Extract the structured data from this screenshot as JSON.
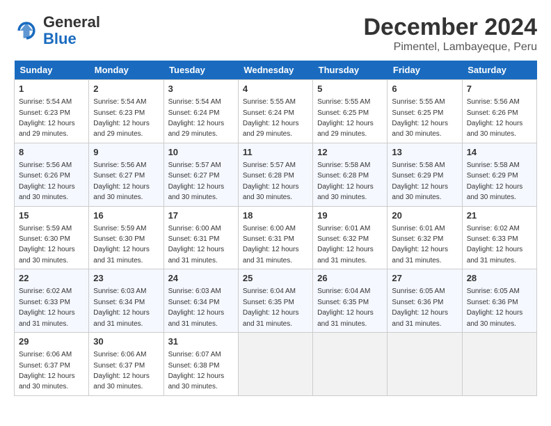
{
  "header": {
    "logo_general": "General",
    "logo_blue": "Blue",
    "month": "December 2024",
    "location": "Pimentel, Lambayeque, Peru"
  },
  "days_of_week": [
    "Sunday",
    "Monday",
    "Tuesday",
    "Wednesday",
    "Thursday",
    "Friday",
    "Saturday"
  ],
  "weeks": [
    [
      {
        "day": 1,
        "info": "Sunrise: 5:54 AM\nSunset: 6:23 PM\nDaylight: 12 hours\nand 29 minutes."
      },
      {
        "day": 2,
        "info": "Sunrise: 5:54 AM\nSunset: 6:23 PM\nDaylight: 12 hours\nand 29 minutes."
      },
      {
        "day": 3,
        "info": "Sunrise: 5:54 AM\nSunset: 6:24 PM\nDaylight: 12 hours\nand 29 minutes."
      },
      {
        "day": 4,
        "info": "Sunrise: 5:55 AM\nSunset: 6:24 PM\nDaylight: 12 hours\nand 29 minutes."
      },
      {
        "day": 5,
        "info": "Sunrise: 5:55 AM\nSunset: 6:25 PM\nDaylight: 12 hours\nand 29 minutes."
      },
      {
        "day": 6,
        "info": "Sunrise: 5:55 AM\nSunset: 6:25 PM\nDaylight: 12 hours\nand 30 minutes."
      },
      {
        "day": 7,
        "info": "Sunrise: 5:56 AM\nSunset: 6:26 PM\nDaylight: 12 hours\nand 30 minutes."
      }
    ],
    [
      {
        "day": 8,
        "info": "Sunrise: 5:56 AM\nSunset: 6:26 PM\nDaylight: 12 hours\nand 30 minutes."
      },
      {
        "day": 9,
        "info": "Sunrise: 5:56 AM\nSunset: 6:27 PM\nDaylight: 12 hours\nand 30 minutes."
      },
      {
        "day": 10,
        "info": "Sunrise: 5:57 AM\nSunset: 6:27 PM\nDaylight: 12 hours\nand 30 minutes."
      },
      {
        "day": 11,
        "info": "Sunrise: 5:57 AM\nSunset: 6:28 PM\nDaylight: 12 hours\nand 30 minutes."
      },
      {
        "day": 12,
        "info": "Sunrise: 5:58 AM\nSunset: 6:28 PM\nDaylight: 12 hours\nand 30 minutes."
      },
      {
        "day": 13,
        "info": "Sunrise: 5:58 AM\nSunset: 6:29 PM\nDaylight: 12 hours\nand 30 minutes."
      },
      {
        "day": 14,
        "info": "Sunrise: 5:58 AM\nSunset: 6:29 PM\nDaylight: 12 hours\nand 30 minutes."
      }
    ],
    [
      {
        "day": 15,
        "info": "Sunrise: 5:59 AM\nSunset: 6:30 PM\nDaylight: 12 hours\nand 30 minutes."
      },
      {
        "day": 16,
        "info": "Sunrise: 5:59 AM\nSunset: 6:30 PM\nDaylight: 12 hours\nand 31 minutes."
      },
      {
        "day": 17,
        "info": "Sunrise: 6:00 AM\nSunset: 6:31 PM\nDaylight: 12 hours\nand 31 minutes."
      },
      {
        "day": 18,
        "info": "Sunrise: 6:00 AM\nSunset: 6:31 PM\nDaylight: 12 hours\nand 31 minutes."
      },
      {
        "day": 19,
        "info": "Sunrise: 6:01 AM\nSunset: 6:32 PM\nDaylight: 12 hours\nand 31 minutes."
      },
      {
        "day": 20,
        "info": "Sunrise: 6:01 AM\nSunset: 6:32 PM\nDaylight: 12 hours\nand 31 minutes."
      },
      {
        "day": 21,
        "info": "Sunrise: 6:02 AM\nSunset: 6:33 PM\nDaylight: 12 hours\nand 31 minutes."
      }
    ],
    [
      {
        "day": 22,
        "info": "Sunrise: 6:02 AM\nSunset: 6:33 PM\nDaylight: 12 hours\nand 31 minutes."
      },
      {
        "day": 23,
        "info": "Sunrise: 6:03 AM\nSunset: 6:34 PM\nDaylight: 12 hours\nand 31 minutes."
      },
      {
        "day": 24,
        "info": "Sunrise: 6:03 AM\nSunset: 6:34 PM\nDaylight: 12 hours\nand 31 minutes."
      },
      {
        "day": 25,
        "info": "Sunrise: 6:04 AM\nSunset: 6:35 PM\nDaylight: 12 hours\nand 31 minutes."
      },
      {
        "day": 26,
        "info": "Sunrise: 6:04 AM\nSunset: 6:35 PM\nDaylight: 12 hours\nand 31 minutes."
      },
      {
        "day": 27,
        "info": "Sunrise: 6:05 AM\nSunset: 6:36 PM\nDaylight: 12 hours\nand 31 minutes."
      },
      {
        "day": 28,
        "info": "Sunrise: 6:05 AM\nSunset: 6:36 PM\nDaylight: 12 hours\nand 30 minutes."
      }
    ],
    [
      {
        "day": 29,
        "info": "Sunrise: 6:06 AM\nSunset: 6:37 PM\nDaylight: 12 hours\nand 30 minutes."
      },
      {
        "day": 30,
        "info": "Sunrise: 6:06 AM\nSunset: 6:37 PM\nDaylight: 12 hours\nand 30 minutes."
      },
      {
        "day": 31,
        "info": "Sunrise: 6:07 AM\nSunset: 6:38 PM\nDaylight: 12 hours\nand 30 minutes."
      },
      null,
      null,
      null,
      null
    ]
  ]
}
